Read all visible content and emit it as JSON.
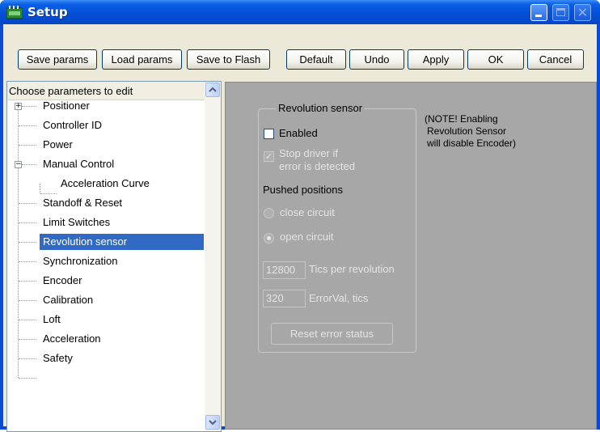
{
  "window": {
    "title": "Setup"
  },
  "toolbar": {
    "save_params": "Save params",
    "load_params": "Load params",
    "save_to_flash": "Save to Flash",
    "default": "Default",
    "undo": "Undo",
    "apply": "Apply",
    "ok": "OK",
    "cancel": "Cancel"
  },
  "tree": {
    "header": "Choose parameters to edit",
    "items": [
      {
        "label": "Positioner",
        "expander": "+"
      },
      {
        "label": "Controller ID"
      },
      {
        "label": "Power"
      },
      {
        "label": "Manual Control",
        "expander": "−"
      },
      {
        "label": "Acceleration Curve"
      },
      {
        "label": "Standoff & Reset"
      },
      {
        "label": "Limit Switches"
      },
      {
        "label": "Revolution sensor",
        "selected": true
      },
      {
        "label": "Synchronization"
      },
      {
        "label": "Encoder"
      },
      {
        "label": "Calibration"
      },
      {
        "label": "Loft"
      },
      {
        "label": "Acceleration"
      },
      {
        "label": "Safety"
      }
    ],
    "selected_label": "Revolution sensor"
  },
  "panel": {
    "group_title": "Revolution sensor",
    "enabled_label": "Enabled",
    "enabled_checked": false,
    "stop_driver_line1": "Stop driver if",
    "stop_driver_line2": "error is detected",
    "stop_driver_checked": true,
    "pushed_positions_label": "Pushed positions",
    "close_circuit_label": "close circuit",
    "open_circuit_label": "open circuit",
    "selected_position": "open circuit",
    "tics_value": "12800",
    "tics_label": "Tics per revolution",
    "errorval_value": "320",
    "errorval_label": "ErrorVal, tics",
    "reset_button": "Reset error status",
    "note_line1": "(NOTE! Enabling",
    "note_line2": "Revolution Sensor",
    "note_line3": "will disable Encoder)"
  },
  "colors": {
    "titlebar": "#0450d8",
    "selection": "#316ac5",
    "panel_bg": "#a7a7a7",
    "client_bg": "#ece9d8"
  }
}
